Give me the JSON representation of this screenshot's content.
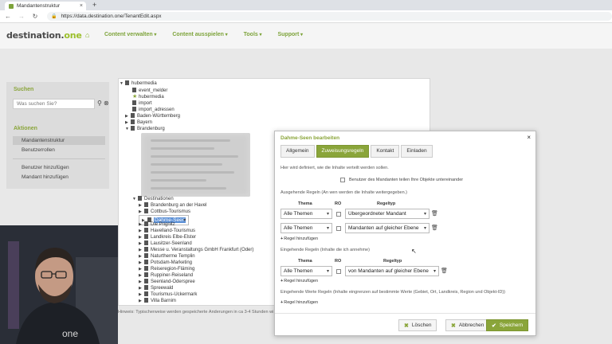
{
  "browser": {
    "tab_title": "Mandantenstruktur",
    "tab_close": "×",
    "new_tab": "+",
    "url": "https://data.destination.one/TenantEdit.aspx"
  },
  "app": {
    "logo_main": "destination.",
    "logo_accent": "one",
    "menu": [
      "Content verwalten",
      "Content ausspielen",
      "Tools",
      "Support"
    ]
  },
  "sidebar": {
    "search_heading": "Suchen",
    "search_placeholder": "Was suchen Sie?",
    "actions_heading": "Aktionen",
    "items": [
      "Mandantenstruktur",
      "Benutzerrollen",
      "Benutzer hinzufügen",
      "Mandant hinzufügen"
    ]
  },
  "tree": {
    "root": "hubermedia",
    "children": [
      "event_melder",
      "hubermedia",
      "import",
      "import_adressen",
      "Baden-Württemberg",
      "Bayern",
      "Brandenburg"
    ],
    "destinations_label": "Destinationen",
    "destinations": [
      "Brandenburg an der Havel",
      "Cottbus-Tourismus",
      "Dahme-Seen",
      "Die Prignitz",
      "Havelland-Tourismus",
      "Landkreis Elbe-Elster",
      "Lausitzer-Seenland",
      "Messe u. Veranstaltungs GmbH Frankfurt (Oder)",
      "Naturtherme Templin",
      "Potsdam-Marketing",
      "Reiseregion-Fläming",
      "Ruppiner-Reiseland",
      "Seenland-Oderspree",
      "Spreewald",
      "Tourismus-Uckermark",
      "Villa Barnim"
    ]
  },
  "hint": "Hinweis: Typischerweise werden gespeicherte Änderungen in ca 3-4 Stunden wi",
  "modal": {
    "title": "Dahme-Seen bearbeiten",
    "close": "×",
    "tabs": [
      "Allgemein",
      "Zuweisungsregeln",
      "Kontakt",
      "Einladen"
    ],
    "description": "Hier wird definiert, wie die Inhalte verteilt werden sollen.",
    "share_checkbox": "Benutzer des Mandanten teilen Ihre Objekte untereinander",
    "outgoing_label": "Ausgehende Regeln (An wen werden die Inhalte weitergegeben.)",
    "incoming_label": "Eingehende Regeln (Inhalte die ich annehme)",
    "value_rules_label": "Eingehende Werte Regeln (Inhalte eingrenzen auf bestimmte Werte (Gebiet, Ort, Landkreis, Region und Objekt-ID))",
    "col_thema": "Thema",
    "col_ro": "RO",
    "col_regeltyp": "Regeltyp",
    "outgoing_rules": [
      {
        "thema": "Alle Themen",
        "regeltyp": "Übergeordneter Mandant"
      },
      {
        "thema": "Alle Themen",
        "regeltyp": "Mandanten auf gleicher Ebene"
      }
    ],
    "incoming_rules": [
      {
        "thema": "Alle Themen",
        "regeltyp": "von Mandanten auf gleicher Ebene"
      }
    ],
    "add_rule": "Regel hinzufügen",
    "buttons": {
      "delete": "Löschen",
      "cancel": "Abbrechen",
      "save": "Speichern"
    }
  }
}
